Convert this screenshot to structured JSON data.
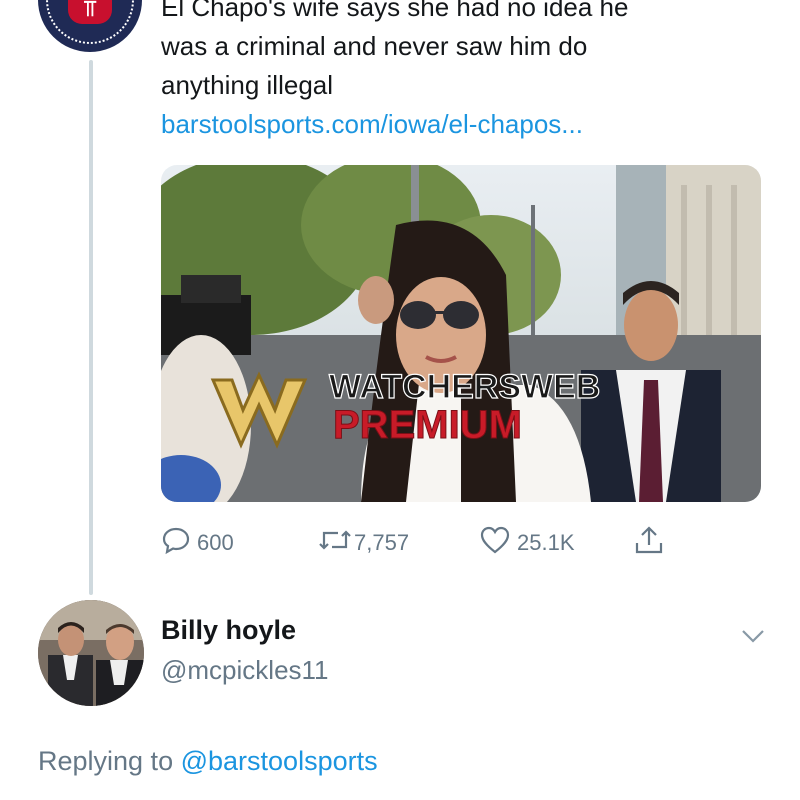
{
  "tweet": {
    "text_lines": [
      "El Chapo's wife says she had no idea he",
      "was a criminal and never saw him do",
      "anything illegal"
    ],
    "link": "barstoolsports.com/iowa/el-chapos...",
    "media": {
      "watermark_top": "WATCHERSWEB",
      "watermark_bottom": "PREMIUM",
      "watermark_logo": "W"
    },
    "actions": {
      "replies": "600",
      "retweets": "7,757",
      "likes": "25.1K"
    }
  },
  "reply": {
    "display_name": "Billy hoyle",
    "handle": "@mcpickles11",
    "replying_prefix": "Replying to",
    "replying_mention": "@barstoolsports"
  },
  "icons": {
    "reply": "reply-bubble-icon",
    "retweet": "retweet-icon",
    "like": "heart-icon",
    "share": "share-icon",
    "menu": "chevron-down-icon"
  },
  "colors": {
    "link": "#1b95e0",
    "text": "#14171a",
    "secondary": "#657786",
    "thread_line": "#cfd9de"
  }
}
